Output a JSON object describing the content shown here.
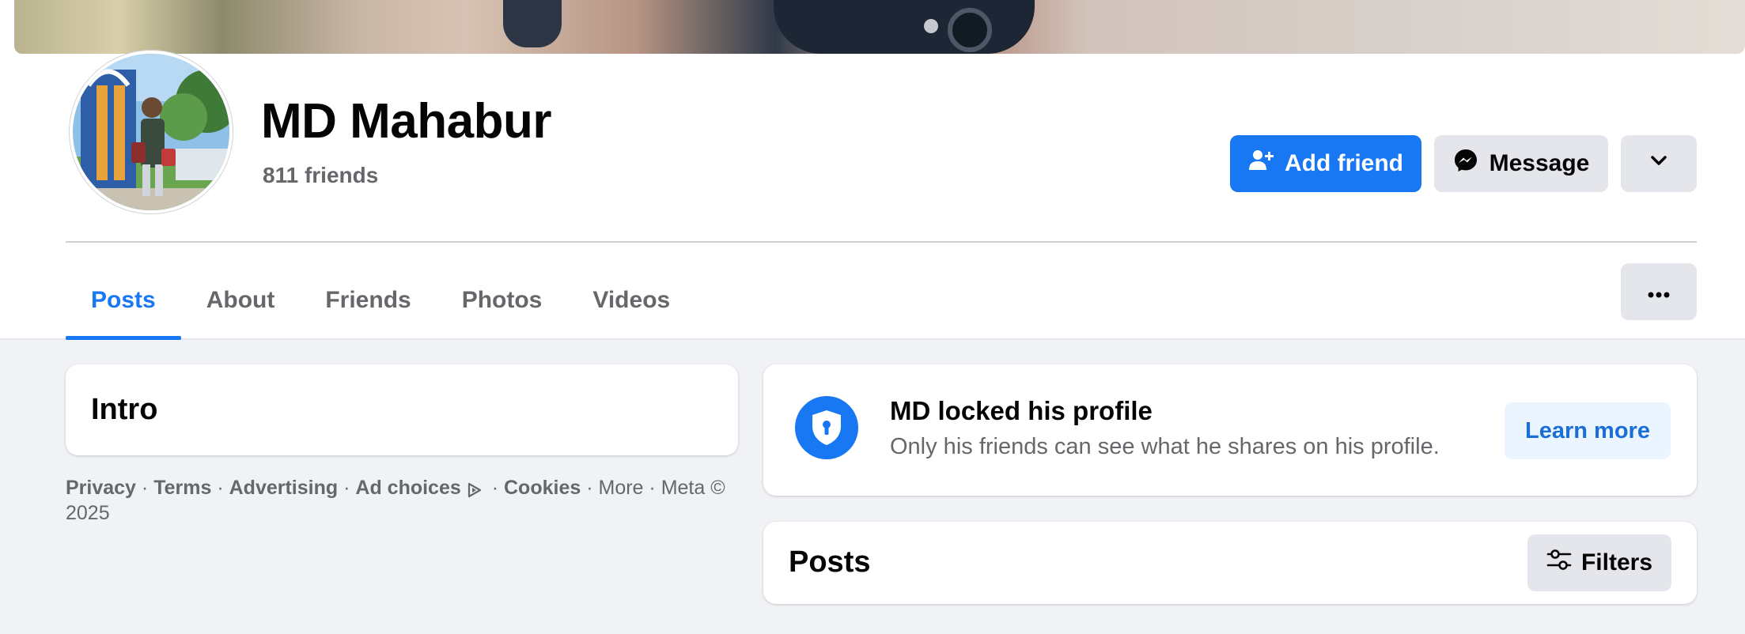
{
  "profile": {
    "name": "MD Mahabur",
    "friends_count": "811 friends"
  },
  "actions": {
    "add_friend": "Add friend",
    "message": "Message"
  },
  "tabs": [
    {
      "label": "Posts",
      "active": true
    },
    {
      "label": "About",
      "active": false
    },
    {
      "label": "Friends",
      "active": false
    },
    {
      "label": "Photos",
      "active": false
    },
    {
      "label": "Videos",
      "active": false
    }
  ],
  "intro": {
    "title": "Intro"
  },
  "footer": {
    "privacy": "Privacy",
    "terms": "Terms",
    "advertising": "Advertising",
    "ad_choices": "Ad choices",
    "cookies": "Cookies",
    "more": "More",
    "meta": "Meta © 2025",
    "separator": "·"
  },
  "locked_notice": {
    "title": "MD locked his profile",
    "subtitle": "Only his friends can see what he shares on his profile.",
    "learn_more": "Learn more"
  },
  "posts_section": {
    "title": "Posts",
    "filters": "Filters"
  },
  "icons": {
    "add_friend": "person-plus-icon",
    "message": "messenger-icon",
    "dropdown": "chevron-down-icon",
    "more": "more-dots-icon",
    "lock": "shield-lock-icon",
    "filters": "sliders-icon",
    "ad_choices": "ad-choices-icon"
  },
  "colors": {
    "accent": "#1877f2",
    "background": "#f0f2f5",
    "secondary_button": "#e4e6eb",
    "muted_text": "#65676b"
  }
}
